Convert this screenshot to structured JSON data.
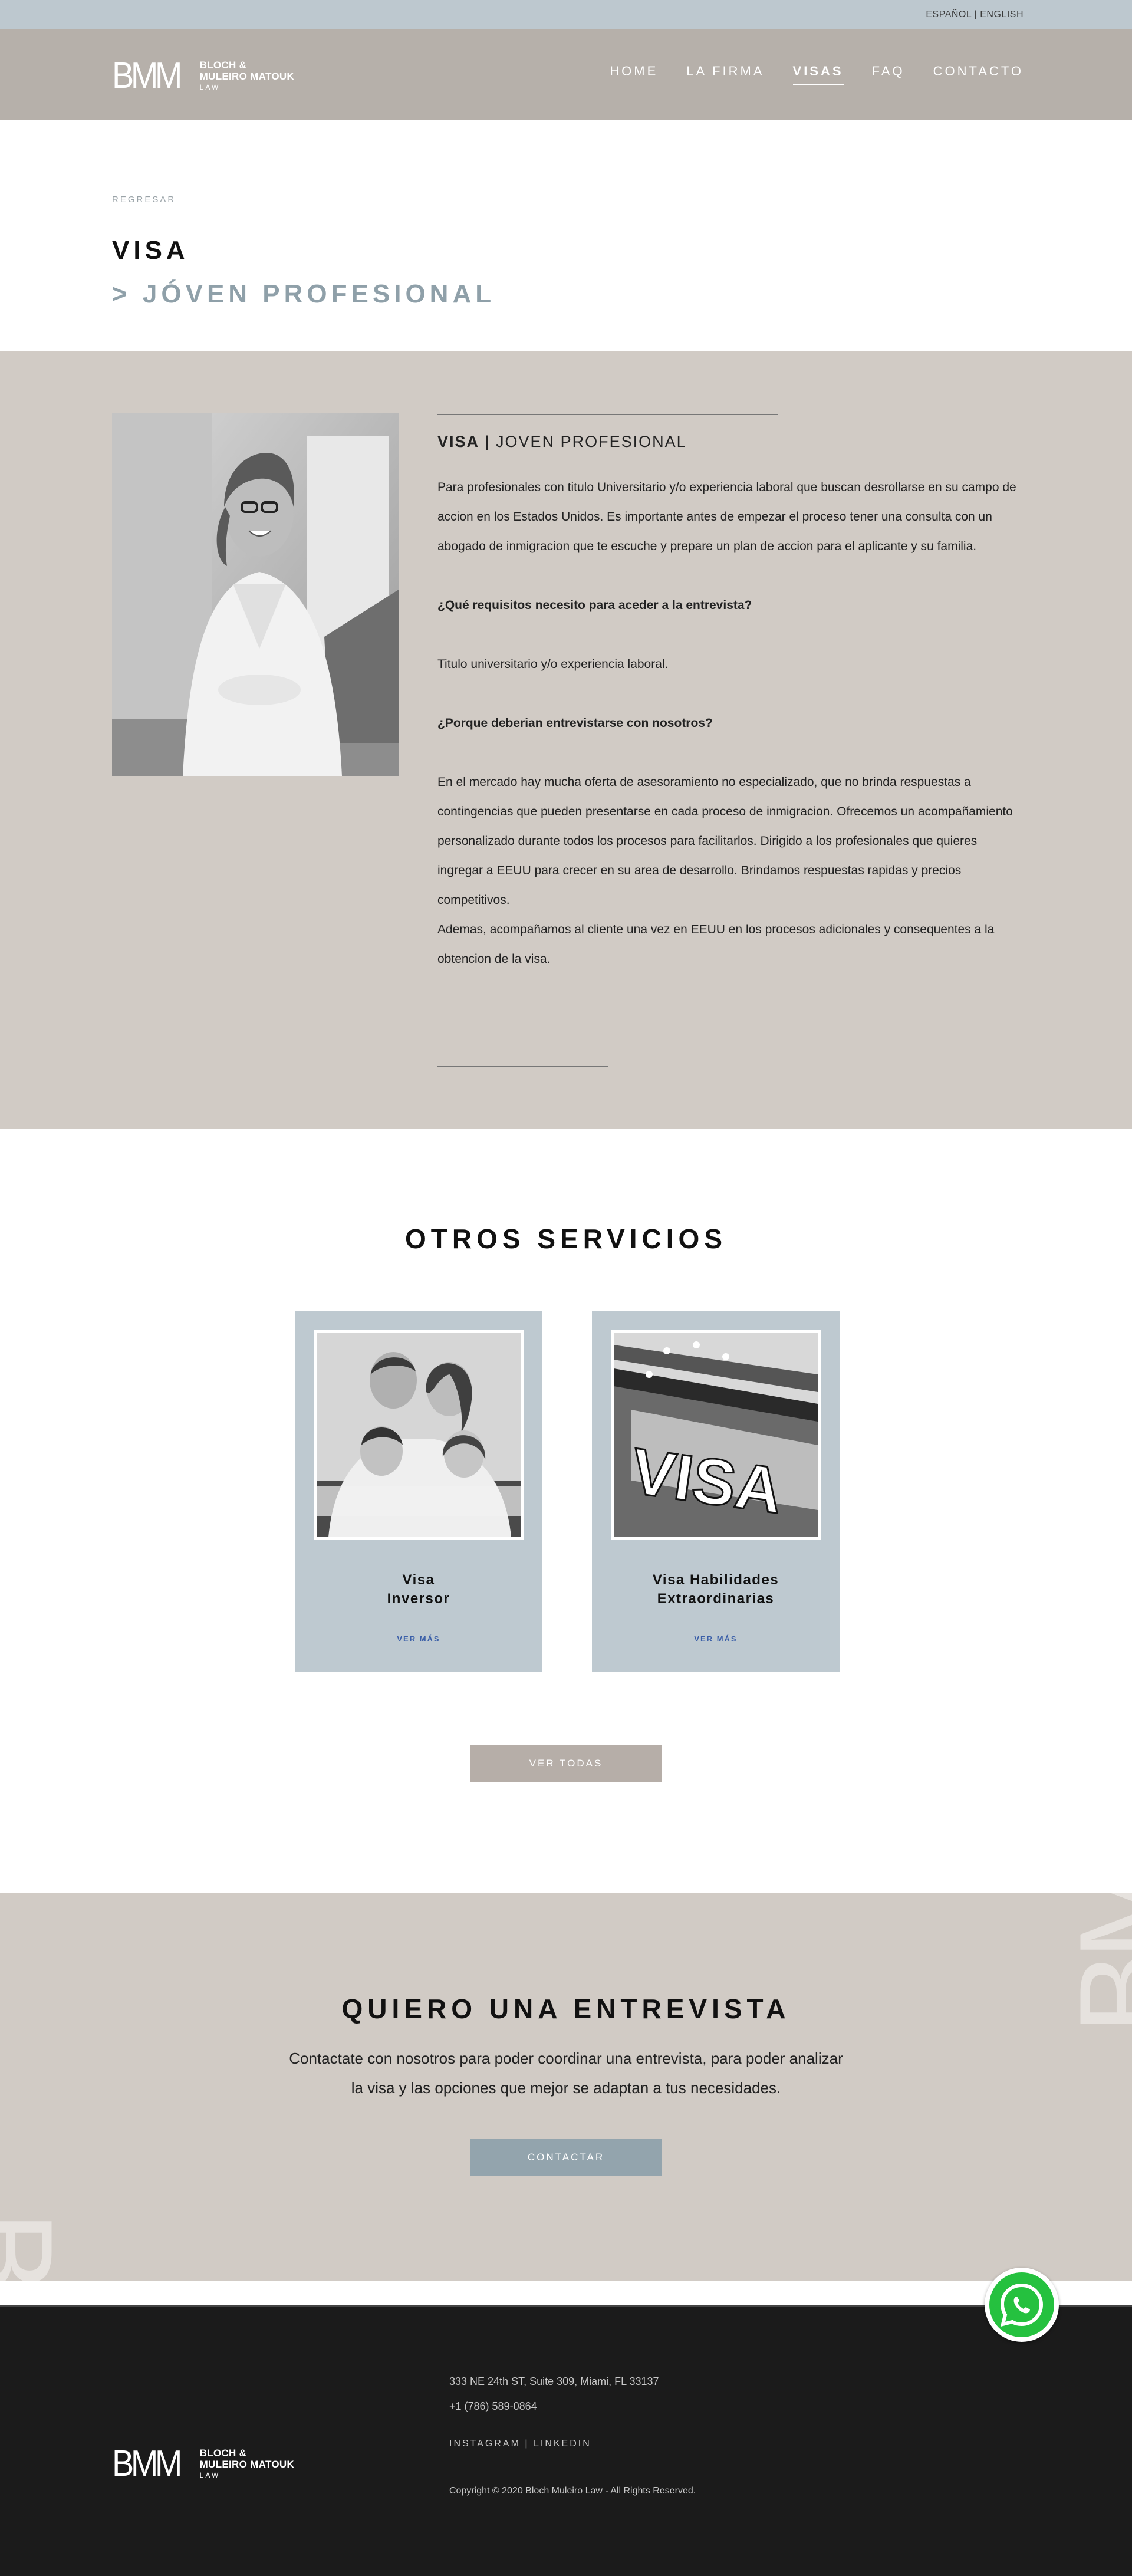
{
  "lang": {
    "es": "ESPAÑOL",
    "sep": "|",
    "en": "ENGLISH"
  },
  "brand": {
    "mono": "BMM",
    "line1": "BLOCH &",
    "line2": "MULEIRO MATOUK",
    "line3": "LAW"
  },
  "nav": [
    {
      "label": "HOME"
    },
    {
      "label": "LA FIRMA"
    },
    {
      "label": "VISAS",
      "active": true
    },
    {
      "label": "FAQ"
    },
    {
      "label": "CONTACTO"
    }
  ],
  "page": {
    "back": "REGRESAR",
    "title": "VISA",
    "subtitle": "> JÓVEN PROFESIONAL"
  },
  "detail": {
    "heading_bold": "VISA",
    "heading_rest": " | JOVEN PROFESIONAL",
    "intro": "Para profesionales con titulo Universitario y/o experiencia laboral que buscan desrollarse en su campo de accion en los Estados Unidos. Es importante antes de empezar el proceso tener una consulta con un abogado de inmigracion que te escuche y prepare un plan de accion para el aplicante y su familia.",
    "q1": "¿Qué requisitos necesito para aceder a la entrevista?",
    "a1": "Titulo universitario y/o experiencia laboral.",
    "q2": "¿Porque deberian entrevistarse con nosotros?",
    "a2_p1": "En el mercado hay mucha oferta de asesoramiento no especializado, que no brinda respuestas a contingencias que pueden presentarse en cada proceso de inmigracion. Ofrecemos un acompañamiento personalizado durante todos los procesos para facilitarlos. Dirigido a los profesionales que quieres ingregar a EEUU para crecer en su area de desarrollo. Brindamos respuestas rapidas y precios competitivos.",
    "a2_p2": "Ademas, acompañamos al cliente una vez en EEUU en los procesos adicionales y consequentes a la obtencion de la visa."
  },
  "otros": {
    "heading": "OTROS SERVICIOS",
    "cards": [
      {
        "name_line1": "Visa",
        "name_line2": "Inversor",
        "more": "VER MÁS"
      },
      {
        "name_line1": "Visa Habilidades",
        "name_line2": "Extraordinarias",
        "more": "VER MÁS"
      }
    ],
    "all_button": "VER TODAS"
  },
  "entrevista": {
    "heading": "QUIERO UNA ENTREVISTA",
    "line1": "Contactate con nosotros para poder coordinar una entrevista, para poder analizar",
    "line2": "la visa y las opciones que mejor se adaptan a tus necesidades.",
    "button": "CONTACTAR",
    "watermark": "BMM"
  },
  "footer": {
    "address": "333 NE 24th ST, Suite 309, Miami, FL 33137",
    "phone": "+1 (786) 589-0864",
    "instagram": "INSTAGRAM",
    "social_sep": " | ",
    "linkedin": "LINKEDIN",
    "copyright": "Copyright © 2020 Bloch Muleiro Law - All Rights Reserved."
  },
  "colors": {
    "langbar": "#bdc8cf",
    "header": "#b6b0aa",
    "section_tan": "#d1cbc5",
    "card_blue": "#bec9d0",
    "footer": "#1b1b1b",
    "whatsapp": "#25c13f"
  },
  "icons": {
    "whatsapp": "whatsapp-icon"
  }
}
